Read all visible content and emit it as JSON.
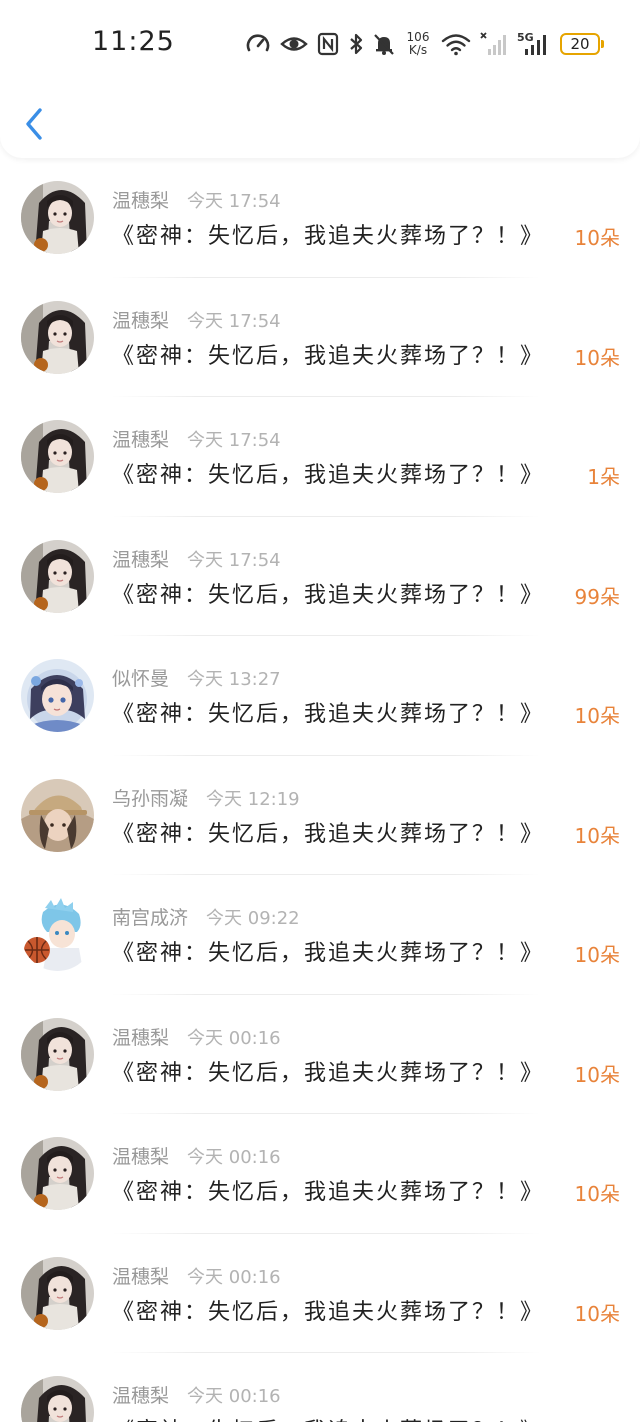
{
  "status_bar": {
    "time": "11:25",
    "net_speed_value": "106",
    "net_speed_unit": "K/s",
    "network_label": "5G",
    "battery_level": "20"
  },
  "colors": {
    "accent_blue": "#3a8ee6",
    "flower_orange": "#e8833a",
    "battery_yellow": "#e6a400"
  },
  "gifts": [
    {
      "user": "温穗梨",
      "time": "今天 17:54",
      "book": "《密神：失忆后，我追夫火葬场了？！》",
      "count": "10朵",
      "avatar": "girl-dark-hair"
    },
    {
      "user": "温穗梨",
      "time": "今天 17:54",
      "book": "《密神：失忆后，我追夫火葬场了？！》",
      "count": "10朵",
      "avatar": "girl-dark-hair"
    },
    {
      "user": "温穗梨",
      "time": "今天 17:54",
      "book": "《密神：失忆后，我追夫火葬场了？！》",
      "count": "1朵",
      "avatar": "girl-dark-hair"
    },
    {
      "user": "温穗梨",
      "time": "今天 17:54",
      "book": "《密神：失忆后，我追夫火葬场了？！》",
      "count": "99朵",
      "avatar": "girl-dark-hair"
    },
    {
      "user": "似怀曼",
      "time": "今天 13:27",
      "book": "《密神：失忆后，我追夫火葬场了？！》",
      "count": "10朵",
      "avatar": "anime-girl-blue"
    },
    {
      "user": "乌孙雨凝",
      "time": "今天 12:19",
      "book": "《密神：失忆后，我追夫火葬场了？！》",
      "count": "10朵",
      "avatar": "girl-cap"
    },
    {
      "user": "南宫成济",
      "time": "今天 09:22",
      "book": "《密神：失忆后，我追夫火葬场了？！》",
      "count": "10朵",
      "avatar": "anime-basketball-boy"
    },
    {
      "user": "温穗梨",
      "time": "今天 00:16",
      "book": "《密神：失忆后，我追夫火葬场了？！》",
      "count": "10朵",
      "avatar": "girl-dark-hair"
    },
    {
      "user": "温穗梨",
      "time": "今天 00:16",
      "book": "《密神：失忆后，我追夫火葬场了？！》",
      "count": "10朵",
      "avatar": "girl-dark-hair"
    },
    {
      "user": "温穗梨",
      "time": "今天 00:16",
      "book": "《密神：失忆后，我追夫火葬场了？！》",
      "count": "10朵",
      "avatar": "girl-dark-hair"
    },
    {
      "user": "温穗梨",
      "time": "今天 00:16",
      "book": "《密神：失忆后，我追夫火葬场了？！》",
      "count": "",
      "avatar": "girl-dark-hair"
    }
  ]
}
